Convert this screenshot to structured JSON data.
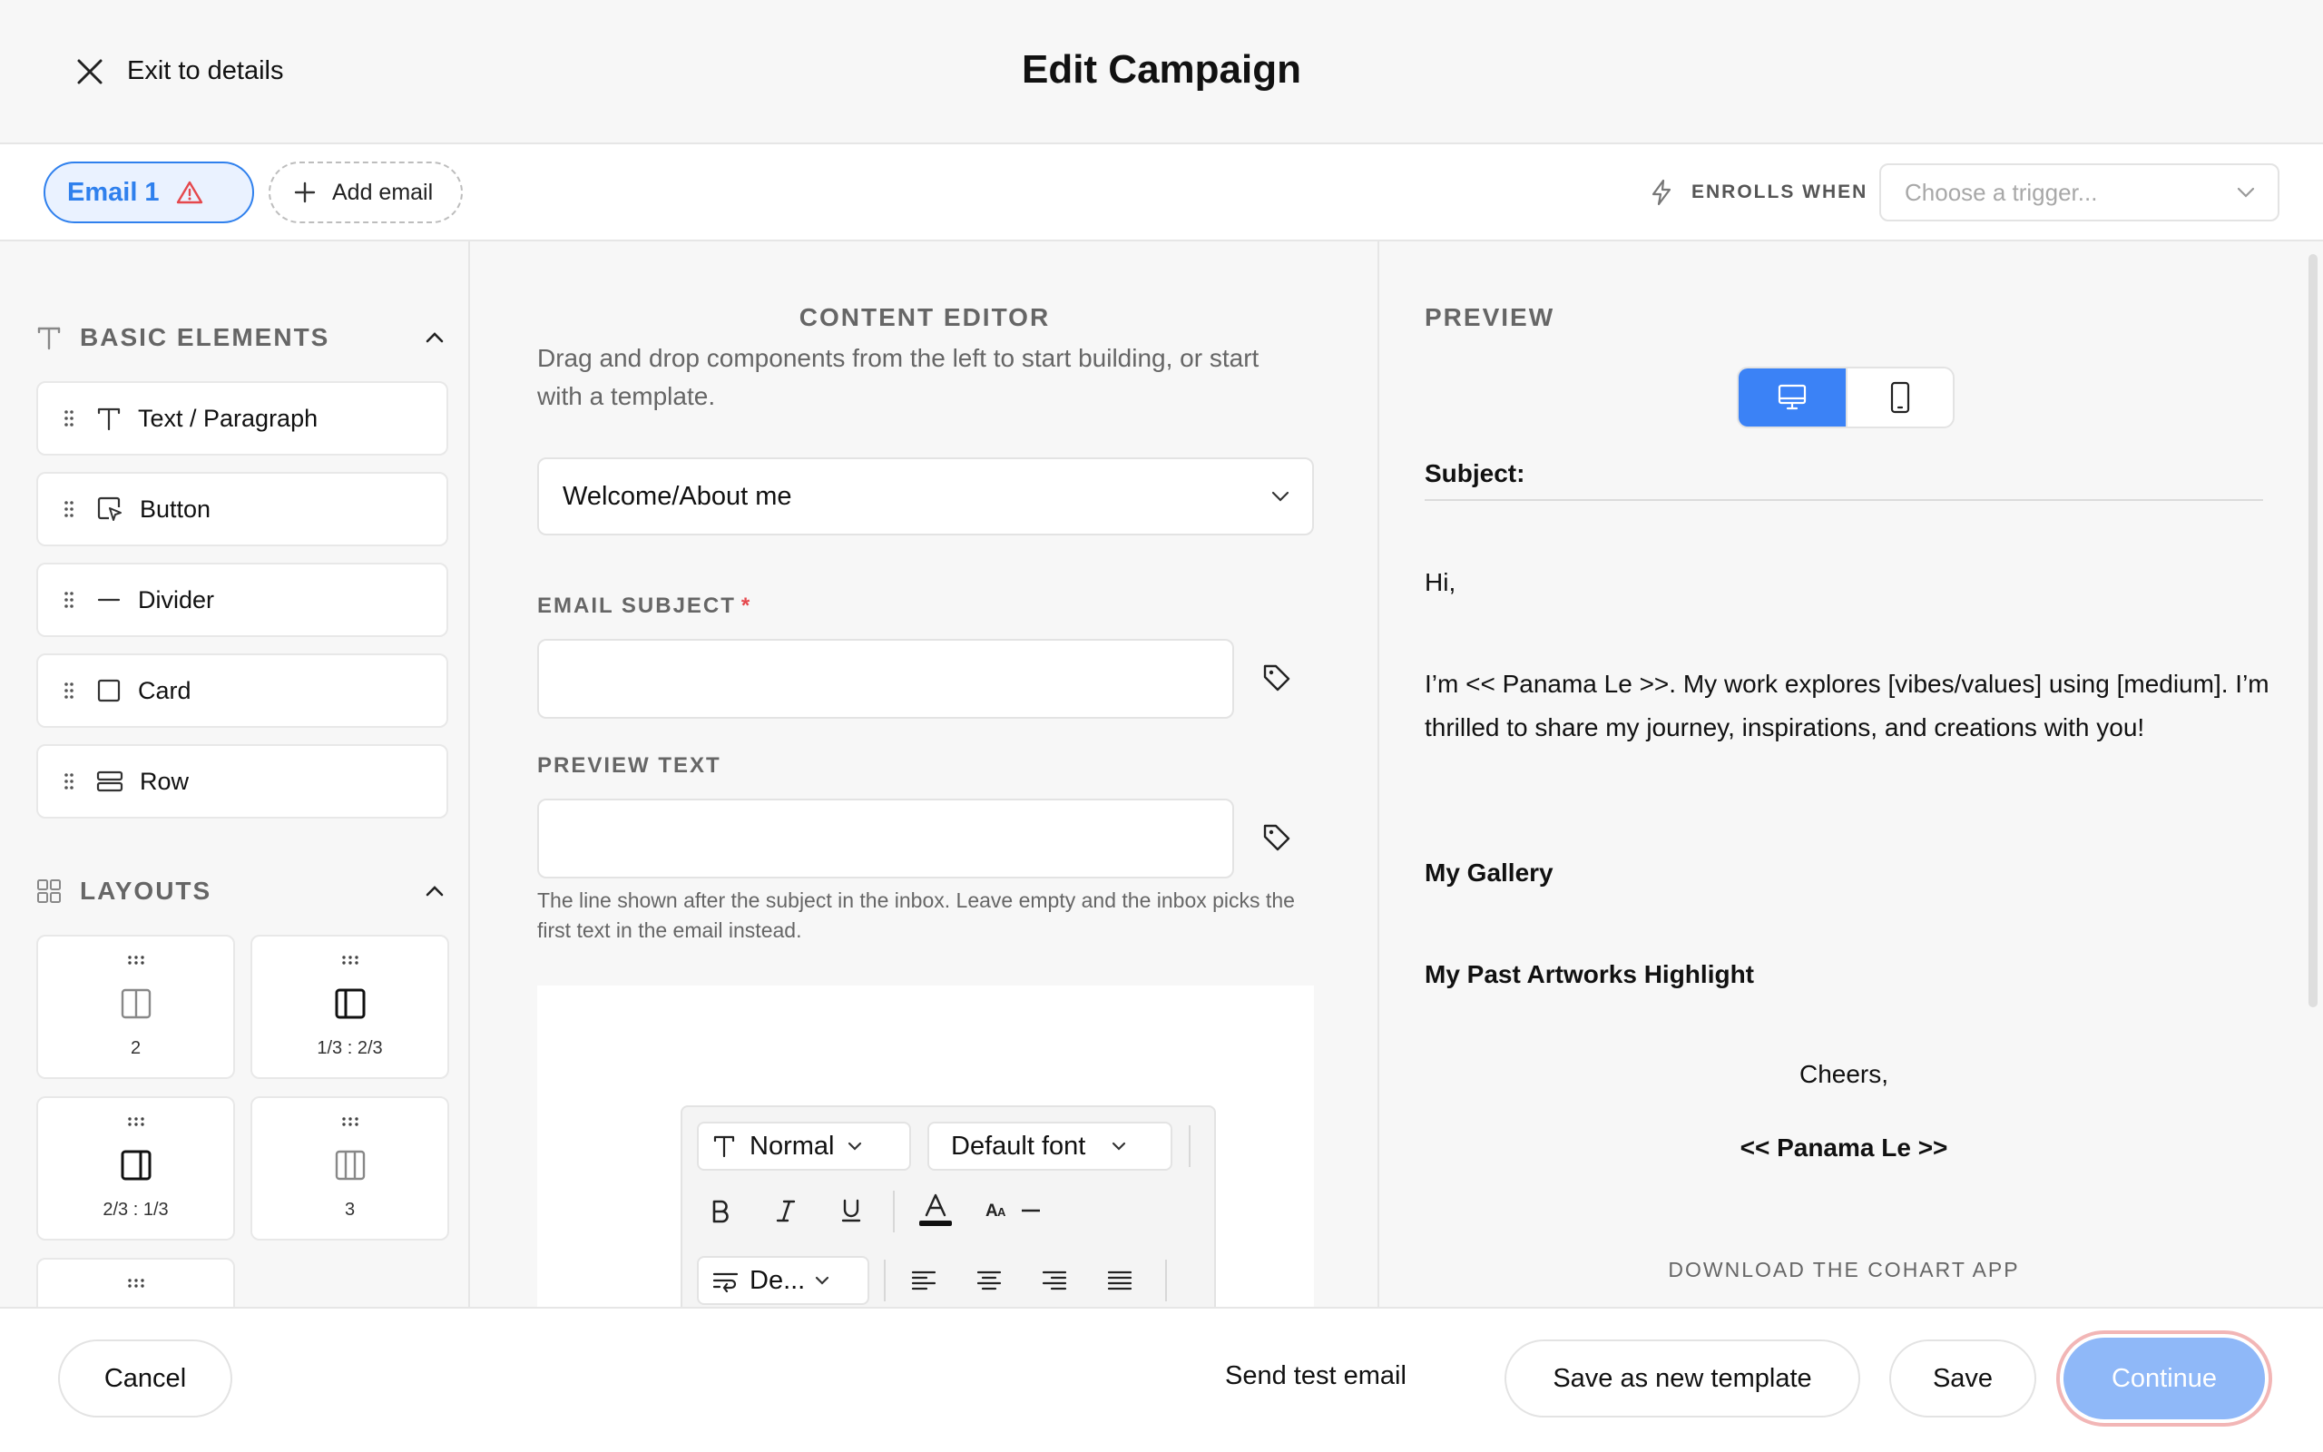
{
  "header": {
    "exit_label": "Exit to details",
    "title": "Edit Campaign"
  },
  "tabs": {
    "email_tab_label": "Email 1",
    "add_email_label": "Add email",
    "enrolls_label": "ENROLLS WHEN",
    "trigger_placeholder": "Choose a trigger..."
  },
  "left_panel": {
    "basic_title": "BASIC ELEMENTS",
    "basic_items": [
      {
        "label": "Text / Paragraph",
        "icon": "text-icon"
      },
      {
        "label": "Button",
        "icon": "button-cursor-icon"
      },
      {
        "label": "Divider",
        "icon": "divider-icon"
      },
      {
        "label": "Card",
        "icon": "card-icon"
      },
      {
        "label": "Row",
        "icon": "row-icon"
      }
    ],
    "layouts_title": "LAYOUTS",
    "layouts": [
      {
        "label": "2"
      },
      {
        "label": "1/3 : 2/3"
      },
      {
        "label": "2/3 : 1/3"
      },
      {
        "label": "3"
      }
    ]
  },
  "content_editor": {
    "title": "CONTENT EDITOR",
    "description": "Drag and drop components from the left to start building, or start with a template.",
    "template_value": "Welcome/About me",
    "subject_label": "EMAIL SUBJECT",
    "subject_required": "*",
    "subject_value": "",
    "preview_label": "PREVIEW TEXT",
    "preview_value": "",
    "preview_help": "The line shown after the subject in the inbox. Leave empty and the inbox picks the first text in the email instead.",
    "toolbar": {
      "style_value": "Normal",
      "font_value": "Default font",
      "wrap_value": "De..."
    }
  },
  "preview": {
    "title": "PREVIEW",
    "subject_label": "Subject:",
    "greeting": "Hi,",
    "intro": "I’m << Panama Le >>. My work explores [vibes/values] using [medium]. I’m thrilled to share my journey, inspirations, and creations with you!",
    "gallery_heading": "My Gallery",
    "highlight_heading": "My Past Artworks Highlight",
    "signoff": "Cheers,",
    "signature": "<< Panama Le >>",
    "download_label": "DOWNLOAD THE COHART APP"
  },
  "footer": {
    "cancel_label": "Cancel",
    "send_test_label": "Send test email",
    "save_template_label": "Save as new template",
    "save_label": "Save",
    "continue_label": "Continue"
  },
  "colors": {
    "accent": "#2f80ed",
    "toggle_active": "#3b82f6",
    "continue_bg": "#8fb8f8",
    "warning": "#e5484d"
  }
}
